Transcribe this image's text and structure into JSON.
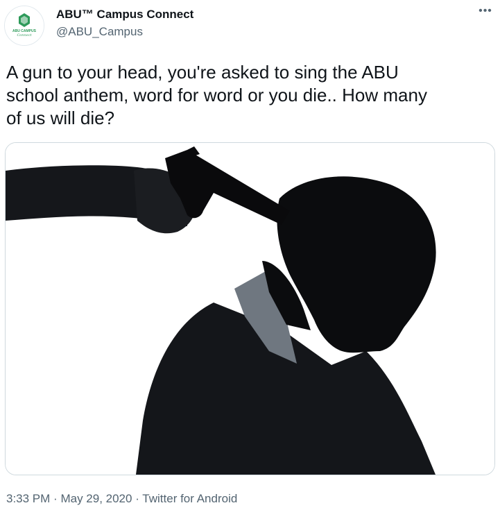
{
  "author": {
    "display_name": "ABU™ Campus Connect",
    "handle": "@ABU_Campus",
    "avatar_icon": "abu-campus-logo",
    "avatar_logo_text": "ABU CAMPUS",
    "avatar_logo_script": "Connect"
  },
  "more_icon": "ellipsis-icon",
  "more_glyph": "•••",
  "tweet": {
    "text": "A gun to your head, you're asked to sing the ABU\nschool anthem, word for word or you die.. How many\nof us will die?"
  },
  "media": {
    "kind": "photo",
    "subject": "silhouette-gun-to-head"
  },
  "meta": {
    "time": "3:33 PM",
    "separator": "·",
    "date": "May 29, 2020",
    "source": "Twitter for Android"
  },
  "colors": {
    "text_primary": "#0f1419",
    "text_secondary": "#536471",
    "border": "#cfd9de",
    "logo_green": "#2e9a5a"
  }
}
